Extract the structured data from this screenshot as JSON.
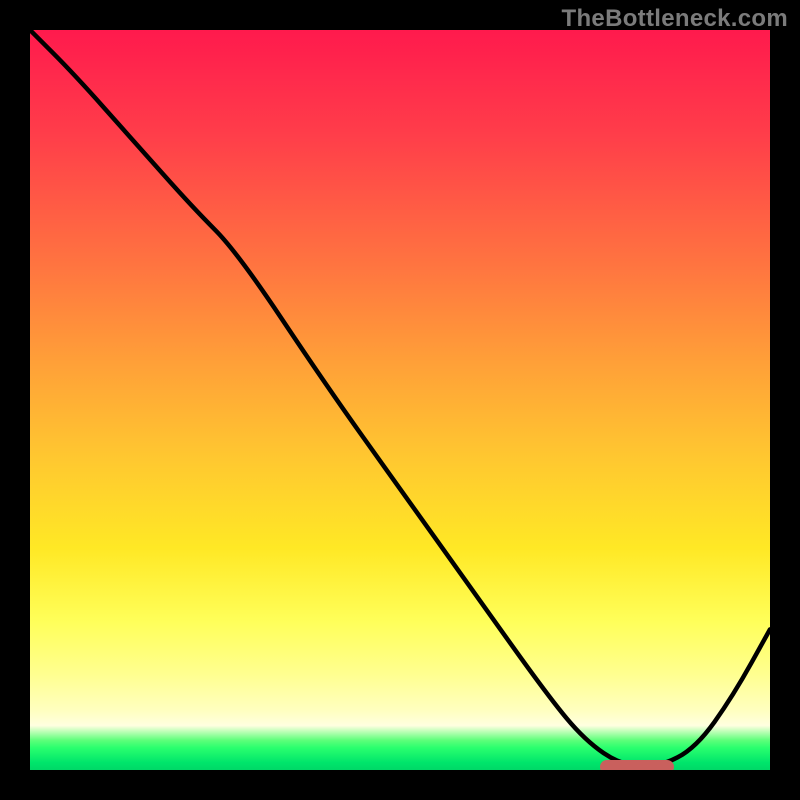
{
  "watermark": "TheBottleneck.com",
  "colors": {
    "frame": "#000000",
    "curve": "#000000",
    "marker": "#c9605d",
    "watermark": "#7b7b7b",
    "gradient_top": "#ff1a4d",
    "gradient_bottom": "#00d867"
  },
  "chart_data": {
    "type": "line",
    "title": "",
    "xlabel": "",
    "ylabel": "",
    "xlim": [
      0,
      1
    ],
    "ylim": [
      0,
      1
    ],
    "x": [
      0.0,
      0.06,
      0.14,
      0.22,
      0.28,
      0.4,
      0.5,
      0.6,
      0.7,
      0.75,
      0.8,
      0.85,
      0.9,
      0.95,
      1.0
    ],
    "values": [
      1.0,
      0.94,
      0.85,
      0.76,
      0.7,
      0.52,
      0.38,
      0.24,
      0.1,
      0.04,
      0.006,
      0.004,
      0.03,
      0.1,
      0.19
    ],
    "marker": {
      "x": 0.82,
      "y": 0.004,
      "width_frac": 0.1,
      "height_frac": 0.018
    },
    "note": "x and y are normalized 0..1. Values estimated from gradient plot; no axes/ticks shown."
  }
}
